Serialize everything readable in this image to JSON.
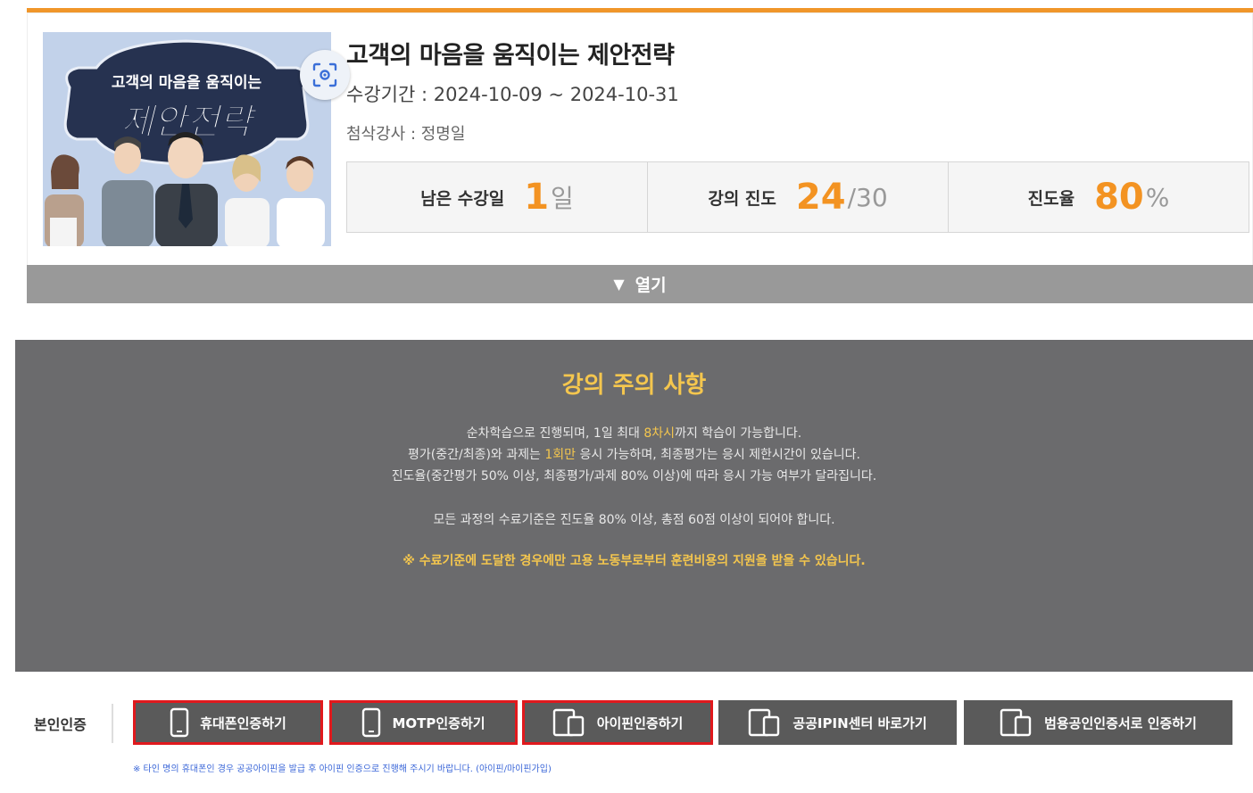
{
  "course": {
    "title": "고객의 마음을 움직이는 제안전략",
    "period_label": "수강기간 : ",
    "period": "2024-10-09 ~ 2024-10-31",
    "tutor_label": "첨삭강사 : ",
    "tutor": "정명일",
    "thumbnail": {
      "subtitle": "고객의 마음을 움직이는",
      "title": "제안전략"
    },
    "stats": [
      {
        "label": "남은 수강일",
        "value": "1",
        "unit": "일"
      },
      {
        "label": "강의 진도",
        "value": "24",
        "unit": "/30"
      },
      {
        "label": "진도율",
        "value": "80",
        "unit": "%"
      }
    ],
    "toggle_label": "열기",
    "accent_color": "#f39322"
  },
  "notice": {
    "title": "강의 주의 사항",
    "line1_a": "순차학습으로 진행되며, 1일 최대 ",
    "line1_hl": "8차시",
    "line1_b": "까지 학습이 가능합니다.",
    "line2_a": "평가(중간/최종)와 과제는 ",
    "line2_hl": "1회만",
    "line2_b": " 응시 가능하며, 최종평가는 응시 제한시간이 있습니다.",
    "line3": "진도율(중간평가 50% 이상, 최종평가/과제 80% 이상)에 따라 응시 가능 여부가 달라집니다.",
    "line4": "모든 과정의 수료기준은 진도율 80% 이상, 총점 60점 이상이 되어야 합니다.",
    "line5": "※ 수료기준에 도달한 경우에만 고용 노동부로부터 훈련비용의 지원을 받을 수 있습니다."
  },
  "verification": {
    "label": "본인인증",
    "buttons": [
      {
        "label": "휴대폰인증하기",
        "icon": "phone-icon"
      },
      {
        "label": "MOTP인증하기",
        "icon": "phone-icon"
      },
      {
        "label": "아이핀인증하기",
        "icon": "ipin-icon"
      },
      {
        "label": "공공IPIN센터 바로가기",
        "icon": "ipin-icon"
      },
      {
        "label": "범용공인인증서로 인증하기",
        "icon": "ipin-icon"
      }
    ],
    "footnote": "※ 타인 명의 휴대폰인 경우 공공아이핀을 발급 후 아이핀 인증으로 진행해 주시기 바랍니다. (아이핀/마이핀가입)"
  }
}
